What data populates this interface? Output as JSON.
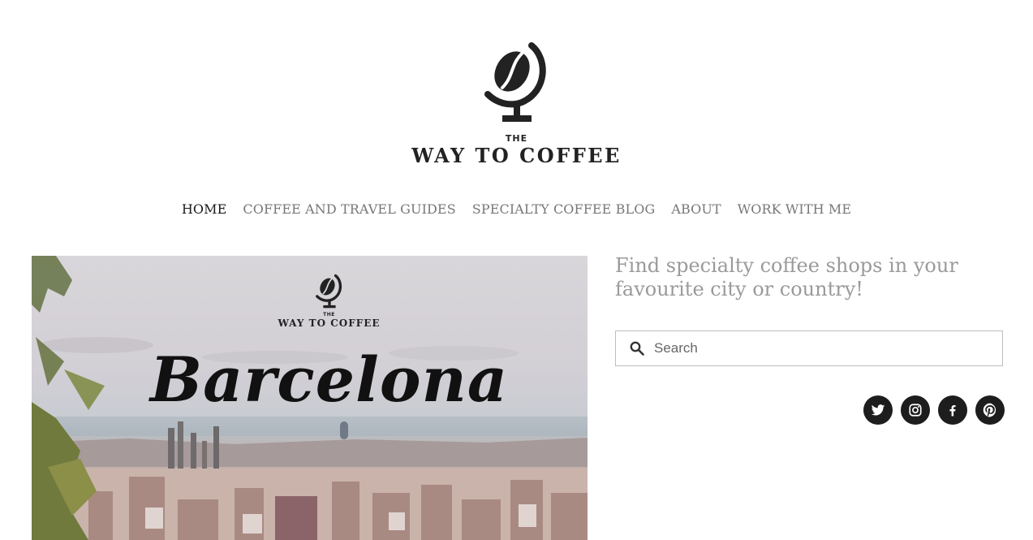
{
  "logo": {
    "the": "THE",
    "name": "WAY TO COFFEE",
    "icon": "coffee-globe-icon"
  },
  "nav": {
    "items": [
      {
        "label": "HOME",
        "active": true
      },
      {
        "label": "COFFEE AND TRAVEL GUIDES",
        "active": false
      },
      {
        "label": "SPECIALTY COFFEE BLOG",
        "active": false
      },
      {
        "label": "ABOUT",
        "active": false
      },
      {
        "label": "WORK WITH ME",
        "active": false
      }
    ]
  },
  "hero": {
    "logo_the": "THE",
    "logo_name": "WAY TO COFFEE",
    "title": "Barcelona"
  },
  "sidebar": {
    "tagline": "Find specialty coffee shops in your favourite city or country!",
    "search": {
      "placeholder": "Search",
      "value": "",
      "icon": "search-icon"
    },
    "social": [
      {
        "name": "twitter",
        "icon": "twitter-icon"
      },
      {
        "name": "instagram",
        "icon": "instagram-icon"
      },
      {
        "name": "facebook",
        "icon": "facebook-icon"
      },
      {
        "name": "pinterest",
        "icon": "pinterest-icon"
      }
    ]
  },
  "colors": {
    "nav_active": "#1a1a1a",
    "nav_inactive": "#777777",
    "tagline": "#9a9a9a",
    "icon_bg": "#1d1d1d"
  }
}
